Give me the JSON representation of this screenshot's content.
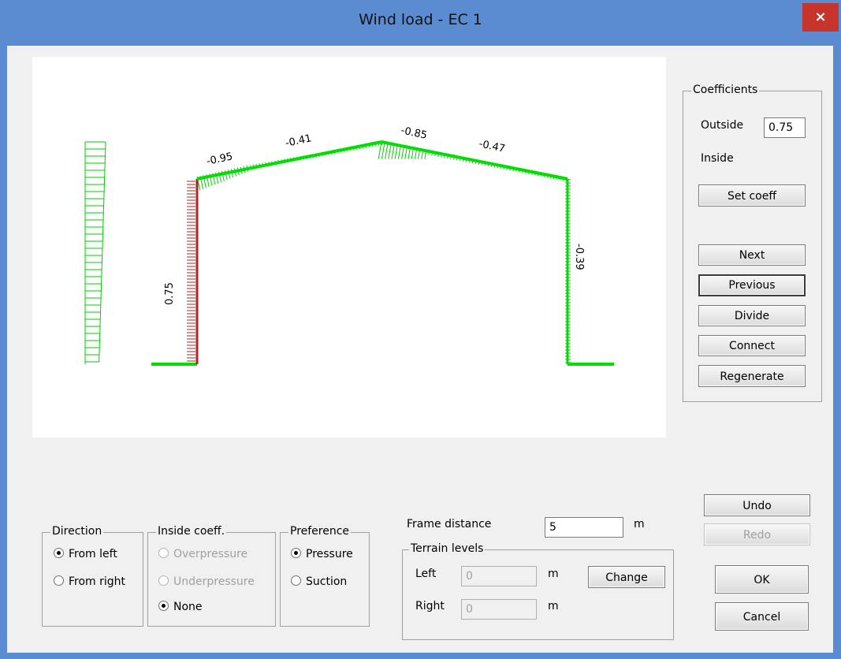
{
  "window": {
    "title": "Wind load - EC 1",
    "close_label": "×"
  },
  "drawing": {
    "labels": {
      "left_column": "0.75",
      "right_column": "-0.39",
      "roof_left_a": "-0.95",
      "roof_left_b": "-0.41",
      "roof_right_a": "-0.85",
      "roof_right_b": "-0.47"
    },
    "colors": {
      "load": "#00cc00",
      "selected": "#b22222",
      "frame": "#00dd00"
    }
  },
  "coefficients": {
    "legend": "Coefficients",
    "outside_label": "Outside",
    "outside_value": "0.75",
    "inside_label": "Inside",
    "set_coeff": "Set coeff"
  },
  "nav_buttons": {
    "next": "Next",
    "previous": "Previous",
    "divide": "Divide",
    "connect": "Connect",
    "regenerate": "Regenerate"
  },
  "direction": {
    "legend": "Direction",
    "from_left": "From left",
    "from_right": "From right",
    "selected": "from_left"
  },
  "inside_coeff": {
    "legend": "Inside coeff.",
    "overpressure": "Overpressure",
    "underpressure": "Underpressure",
    "none": "None",
    "selected": "none"
  },
  "preference": {
    "legend": "Preference",
    "pressure": "Pressure",
    "suction": "Suction",
    "selected": "pressure"
  },
  "frame": {
    "distance_label": "Frame distance",
    "distance_value": "5",
    "unit": "m"
  },
  "terrain": {
    "legend": "Terrain levels",
    "left_label": "Left",
    "left_value": "0",
    "left_unit": "m",
    "right_label": "Right",
    "right_value": "0",
    "right_unit": "m",
    "change": "Change"
  },
  "actions": {
    "undo": "Undo",
    "redo": "Redo",
    "ok": "OK",
    "cancel": "Cancel"
  }
}
